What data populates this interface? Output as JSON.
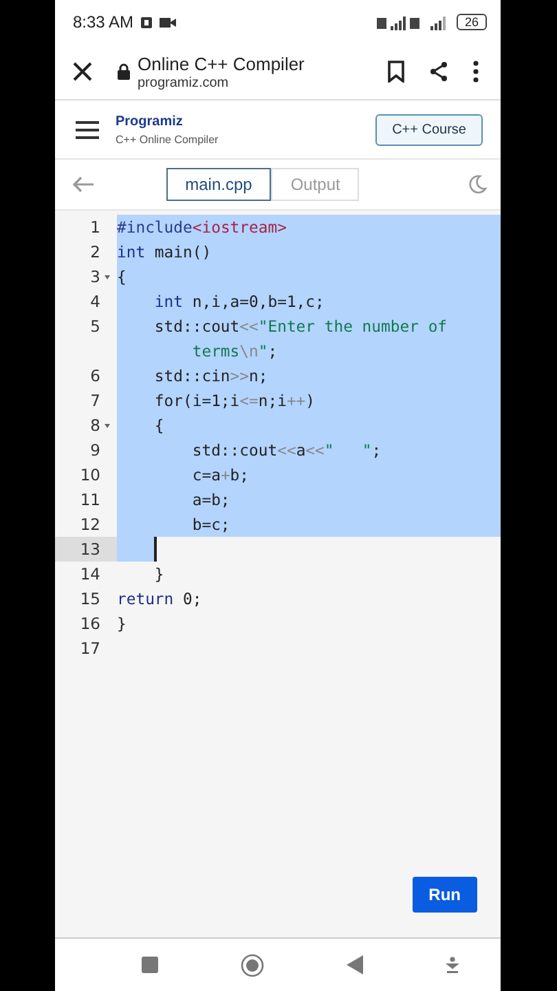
{
  "status_bar": {
    "time": "8:33 AM",
    "battery": "26"
  },
  "browser_bar": {
    "title": "Online C++ Compiler",
    "url": "programiz.com"
  },
  "site_header": {
    "logo": "Programiz",
    "subtitle": "C++ Online Compiler",
    "button": "C++ Course"
  },
  "tabs": [
    {
      "label": "main.cpp",
      "selected": true
    },
    {
      "label": "Output",
      "selected": false
    }
  ],
  "code_lines": [
    {
      "number": "1",
      "fold": false,
      "selected": true,
      "cursor": false,
      "tokens": [
        {
          "kind": "meta",
          "text": "#include"
        },
        {
          "kind": "header",
          "text": "<iostream>"
        }
      ]
    },
    {
      "number": "2",
      "fold": false,
      "selected": true,
      "cursor": false,
      "tokens": [
        {
          "kind": "kw",
          "text": "int"
        },
        {
          "kind": "plain",
          "text": " main()"
        }
      ]
    },
    {
      "number": "3",
      "fold": true,
      "selected": true,
      "cursor": false,
      "tokens": [
        {
          "kind": "plain",
          "text": "{"
        }
      ]
    },
    {
      "number": "4",
      "fold": false,
      "selected": true,
      "cursor": false,
      "tokens": [
        {
          "kind": "kw",
          "text": "    int"
        },
        {
          "kind": "plain",
          "text": " n,i,a=0,b=1,c;"
        }
      ]
    },
    {
      "number": "5",
      "fold": false,
      "selected": true,
      "cursor": false,
      "tokens": [
        {
          "kind": "plain",
          "text": "    std::cout"
        },
        {
          "kind": "op",
          "text": "<<"
        },
        {
          "kind": "str",
          "text": "\"Enter the number of"
        }
      ],
      "wrap": [
        {
          "kind": "str",
          "text": "        terms"
        },
        {
          "kind": "op",
          "text": "\\n"
        },
        {
          "kind": "str",
          "text": "\""
        },
        {
          "kind": "plain",
          "text": ";"
        }
      ]
    },
    {
      "number": "6",
      "fold": false,
      "selected": true,
      "cursor": false,
      "tokens": [
        {
          "kind": "plain",
          "text": "    std::cin"
        },
        {
          "kind": "op",
          "text": ">>"
        },
        {
          "kind": "plain",
          "text": "n;"
        }
      ]
    },
    {
      "number": "7",
      "fold": false,
      "selected": true,
      "cursor": false,
      "tokens": [
        {
          "kind": "plain",
          "text": "    for(i=1;i"
        },
        {
          "kind": "op",
          "text": "<="
        },
        {
          "kind": "plain",
          "text": "n;i"
        },
        {
          "kind": "op",
          "text": "++"
        },
        {
          "kind": "plain",
          "text": ")"
        }
      ]
    },
    {
      "number": "8",
      "fold": true,
      "selected": true,
      "cursor": false,
      "tokens": [
        {
          "kind": "plain",
          "text": "    {"
        }
      ]
    },
    {
      "number": "9",
      "fold": false,
      "selected": true,
      "cursor": false,
      "tokens": [
        {
          "kind": "plain",
          "text": "        std::cout"
        },
        {
          "kind": "op",
          "text": "<<"
        },
        {
          "kind": "plain",
          "text": "a"
        },
        {
          "kind": "op",
          "text": "<<"
        },
        {
          "kind": "str",
          "text": "\"   \""
        },
        {
          "kind": "plain",
          "text": ";"
        }
      ]
    },
    {
      "number": "10",
      "fold": false,
      "selected": true,
      "cursor": false,
      "tokens": [
        {
          "kind": "plain",
          "text": "        c=a"
        },
        {
          "kind": "op",
          "text": "+"
        },
        {
          "kind": "plain",
          "text": "b;"
        }
      ]
    },
    {
      "number": "11",
      "fold": false,
      "selected": true,
      "cursor": false,
      "tokens": [
        {
          "kind": "plain",
          "text": "        a=b;"
        }
      ]
    },
    {
      "number": "12",
      "fold": false,
      "selected": true,
      "cursor": false,
      "tokens": [
        {
          "kind": "plain",
          "text": "        b=c;"
        }
      ]
    },
    {
      "number": "13",
      "fold": false,
      "selected": true,
      "cursor": true
    },
    {
      "number": "14",
      "fold": false,
      "selected": false,
      "cursor": false,
      "tokens": [
        {
          "kind": "plain",
          "text": "    }"
        }
      ]
    },
    {
      "number": "15",
      "fold": false,
      "selected": false,
      "cursor": false,
      "tokens": [
        {
          "kind": "kw",
          "text": "return"
        },
        {
          "kind": "plain",
          "text": " 0;"
        }
      ]
    },
    {
      "number": "16",
      "fold": false,
      "selected": false,
      "cursor": false,
      "tokens": [
        {
          "kind": "plain",
          "text": "}"
        }
      ]
    },
    {
      "number": "17",
      "fold": false,
      "selected": false,
      "cursor": false
    }
  ],
  "run_button": "Run"
}
